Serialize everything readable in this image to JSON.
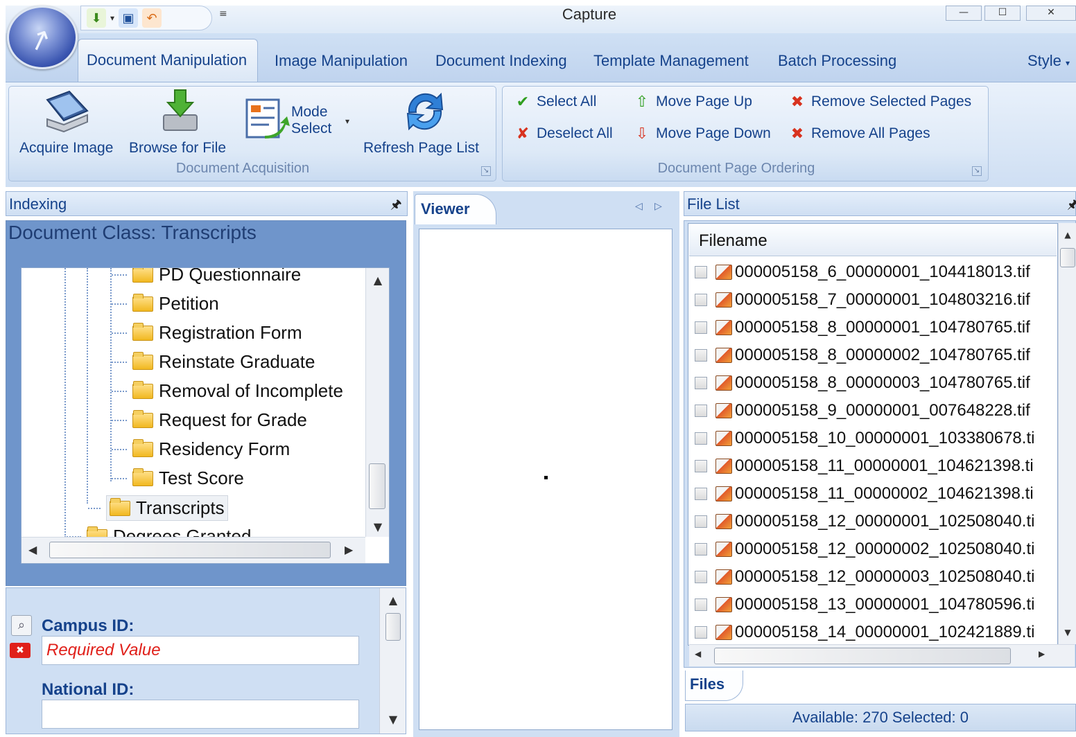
{
  "window": {
    "title": "Capture",
    "controls": [
      "—",
      "☐",
      "✕"
    ]
  },
  "quick_access": {
    "dropdown_glyph": "≡"
  },
  "tabs": [
    {
      "label": "Document Manipulation",
      "active": true
    },
    {
      "label": "Image Manipulation"
    },
    {
      "label": "Document Indexing"
    },
    {
      "label": "Template Management"
    },
    {
      "label": "Batch Processing"
    }
  ],
  "style_menu": "Style",
  "ribbon": {
    "acquisition": {
      "label": "Document Acquisition",
      "acquire_image": "Acquire Image",
      "browse_for_file": "Browse for File",
      "mode_select_line1": "Mode",
      "mode_select_line2": "Select",
      "refresh_page_list": "Refresh Page List"
    },
    "page_ordering": {
      "label": "Document Page Ordering",
      "select_all": "Select All",
      "deselect_all": "Deselect All",
      "move_page_up": "Move Page Up",
      "move_page_down": "Move Page Down",
      "remove_selected_pages": "Remove Selected Pages",
      "remove_all_pages": "Remove All Pages"
    }
  },
  "indexing": {
    "title": "Indexing",
    "document_class": "Document Class: Transcripts",
    "tree_items": [
      "PD Questionnaire",
      "Petition",
      "Registration Form",
      "Reinstate Graduate",
      "Removal of Incomplete",
      "Request for Grade",
      "Residency Form",
      "Test Score",
      "Transcripts",
      "Degrees Granted"
    ],
    "fields": {
      "campus_id_label": "Campus ID:",
      "campus_id_value": "Required Value",
      "national_id_label": "National ID:",
      "national_id_value": ""
    }
  },
  "viewer": {
    "title": "Viewer"
  },
  "file_list": {
    "title": "File List",
    "column_header": "Filename",
    "rows": [
      "000005158_6_00000001_104418013.tif",
      "000005158_7_00000001_104803216.tif",
      "000005158_8_00000001_104780765.tif",
      "000005158_8_00000002_104780765.tif",
      "000005158_8_00000003_104780765.tif",
      "000005158_9_00000001_007648228.tif",
      "000005158_10_00000001_103380678.ti",
      "000005158_11_00000001_104621398.ti",
      "000005158_11_00000002_104621398.ti",
      "000005158_12_00000001_102508040.ti",
      "000005158_12_00000002_102508040.ti",
      "000005158_12_00000003_102508040.ti",
      "000005158_13_00000001_104780596.ti",
      "000005158_14_00000001_102421889.ti"
    ],
    "tab_label": "Files",
    "status": "Available: 270   Selected: 0"
  },
  "colors": {
    "accent": "#15428b",
    "ribbon_bg": "#cfdff3",
    "indexing_bg": "#6f95cb",
    "required": "#e0201a"
  },
  "icons": [
    "app-orb-icon",
    "scanner-icon",
    "download-icon",
    "mode-select-icon",
    "refresh-icon",
    "checkmark-icon",
    "uncheck-icon",
    "page-up-icon",
    "page-down-icon",
    "remove-page-icon",
    "remove-all-icon",
    "pin-icon",
    "folder-icon",
    "search-icon",
    "error-icon",
    "image-file-icon"
  ]
}
